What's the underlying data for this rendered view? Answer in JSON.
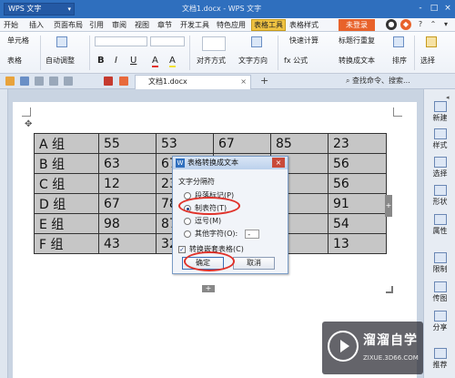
{
  "titlebar": {
    "app_name": "WPS 文字",
    "doc_title": "文档1.docx - WPS 文字",
    "controls": [
      "-",
      "□",
      "×"
    ]
  },
  "menubar": {
    "items": [
      "开始",
      "插入",
      "页面布局",
      "引用",
      "审阅",
      "视图",
      "章节",
      "开发工具",
      "特色应用",
      "表格工具",
      "表格样式"
    ],
    "active_item": "表格工具",
    "login_label": "未登录"
  },
  "ribbon": {
    "cell_label": "单元格",
    "table_label": "表格",
    "auto_adjust": "自动调整",
    "font_name": "",
    "font_size": "",
    "bold": "B",
    "italic": "I",
    "underline": "U",
    "font_color": "A",
    "highlight": "A",
    "align_label": "对齐方式",
    "text_dir_label": "文字方向",
    "formula_label": "fx 公式",
    "quick_calc": "快速计算",
    "header_repeat": "标题行重复",
    "convert_text": "转换成文本",
    "sort_label": "排序",
    "select_label": "选择"
  },
  "tabbar": {
    "doc_tab": "文档1.docx",
    "search_placeholder": "查找命令、搜索..."
  },
  "table": {
    "rows": [
      [
        "A 组",
        "55",
        "53",
        "67",
        "85",
        "23"
      ],
      [
        "B 组",
        "63",
        "67",
        "",
        "",
        "56"
      ],
      [
        "C 组",
        "12",
        "23",
        "",
        "",
        "56"
      ],
      [
        "D 组",
        "67",
        "78",
        "",
        "",
        "91"
      ],
      [
        "E 组",
        "98",
        "87",
        "",
        "",
        "54"
      ],
      [
        "F 组",
        "43",
        "32",
        "",
        "",
        "13"
      ]
    ]
  },
  "dialog": {
    "title": "表格转换成文本",
    "group_label": "文字分隔符",
    "options": [
      {
        "label": "段落标记(P)",
        "selected": false
      },
      {
        "label": "制表符(T)",
        "selected": true
      },
      {
        "label": "逗号(M)",
        "selected": false
      },
      {
        "label": "其他字符(O):",
        "selected": false
      }
    ],
    "other_value": "-",
    "nested_label": "转换嵌套表格(C)",
    "nested_checked": true,
    "ok_label": "确定",
    "cancel_label": "取消"
  },
  "sidebar": {
    "items": [
      "新建",
      "样式",
      "选择",
      "形状",
      "属性",
      "限制",
      "传图",
      "分享",
      "推荐"
    ]
  },
  "watermark": {
    "title": "溜溜自学",
    "url": "ZIXUE.3D66.COM"
  },
  "colors": {
    "title_bar": "#2f6fbe",
    "active_tab": "#f0c342",
    "login": "#e8622a",
    "highlight_circle": "#e0322a",
    "table_fill": "#c6c6c6"
  }
}
